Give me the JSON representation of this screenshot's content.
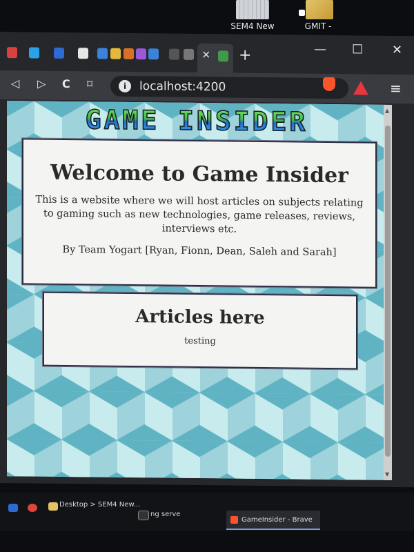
{
  "desktop": {
    "icons": [
      {
        "label": "SEM4 New"
      },
      {
        "label": "GMIT -"
      }
    ]
  },
  "browser": {
    "tab_close": "×",
    "new_tab": "+",
    "window_controls": {
      "minimize": "—",
      "maximize": "☐",
      "close": "✕"
    },
    "nav": {
      "back": "◁",
      "forward": "▷",
      "reload": "C",
      "bookmark": "⌑"
    },
    "url": "localhost:4200",
    "menu": "≡",
    "pinned_tab_colors": [
      "#d94040",
      "#2aa2e8",
      "#2d6ad1",
      "#e6e6e6",
      "#3b82d9",
      "#e3b83c",
      "#d9702a",
      "#9b59d9",
      "#3b82d9",
      "#555555",
      "#777777",
      "#3f9b4a"
    ]
  },
  "page": {
    "logo": "GAME INSIDER",
    "welcome": {
      "title": "Welcome to Game Insider",
      "description": "This is a website where we will host articles on subjects relating to gaming such as new technologies, game releases, reviews, interviews etc.",
      "byline": "By Team Yogart [Ryan, Fionn, Dean, Saleh and Sarah]"
    },
    "articles": {
      "title": "Articles here",
      "body": "testing"
    }
  },
  "taskbar": {
    "items": [
      {
        "label": "Desktop > SEM4 New..."
      },
      {
        "label": "ng serve"
      },
      {
        "label": "GameInsider - Brave"
      }
    ]
  },
  "colors": {
    "brand_brave": "#fb542b",
    "card_border": "#2b2d45",
    "background_teal": "#5fb3c2"
  }
}
